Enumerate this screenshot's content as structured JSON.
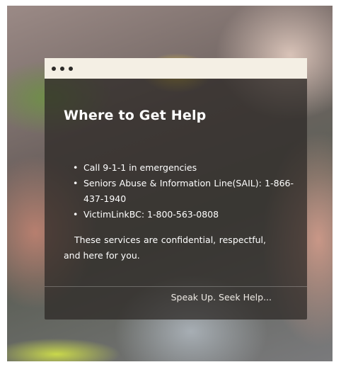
{
  "card": {
    "title": "Where to Get Help",
    "items": [
      {
        "text": "Call 9-1-1 in emergencies"
      },
      {
        "text": "Seniors Abuse & Information Line(SAIL): 1-866-437-1940"
      },
      {
        "text": "VictimLinkBC: 1-800-563-0808"
      }
    ],
    "note": "These services are confidential, respectful, and here for you.",
    "footer": "Speak Up. Seek Help..."
  }
}
